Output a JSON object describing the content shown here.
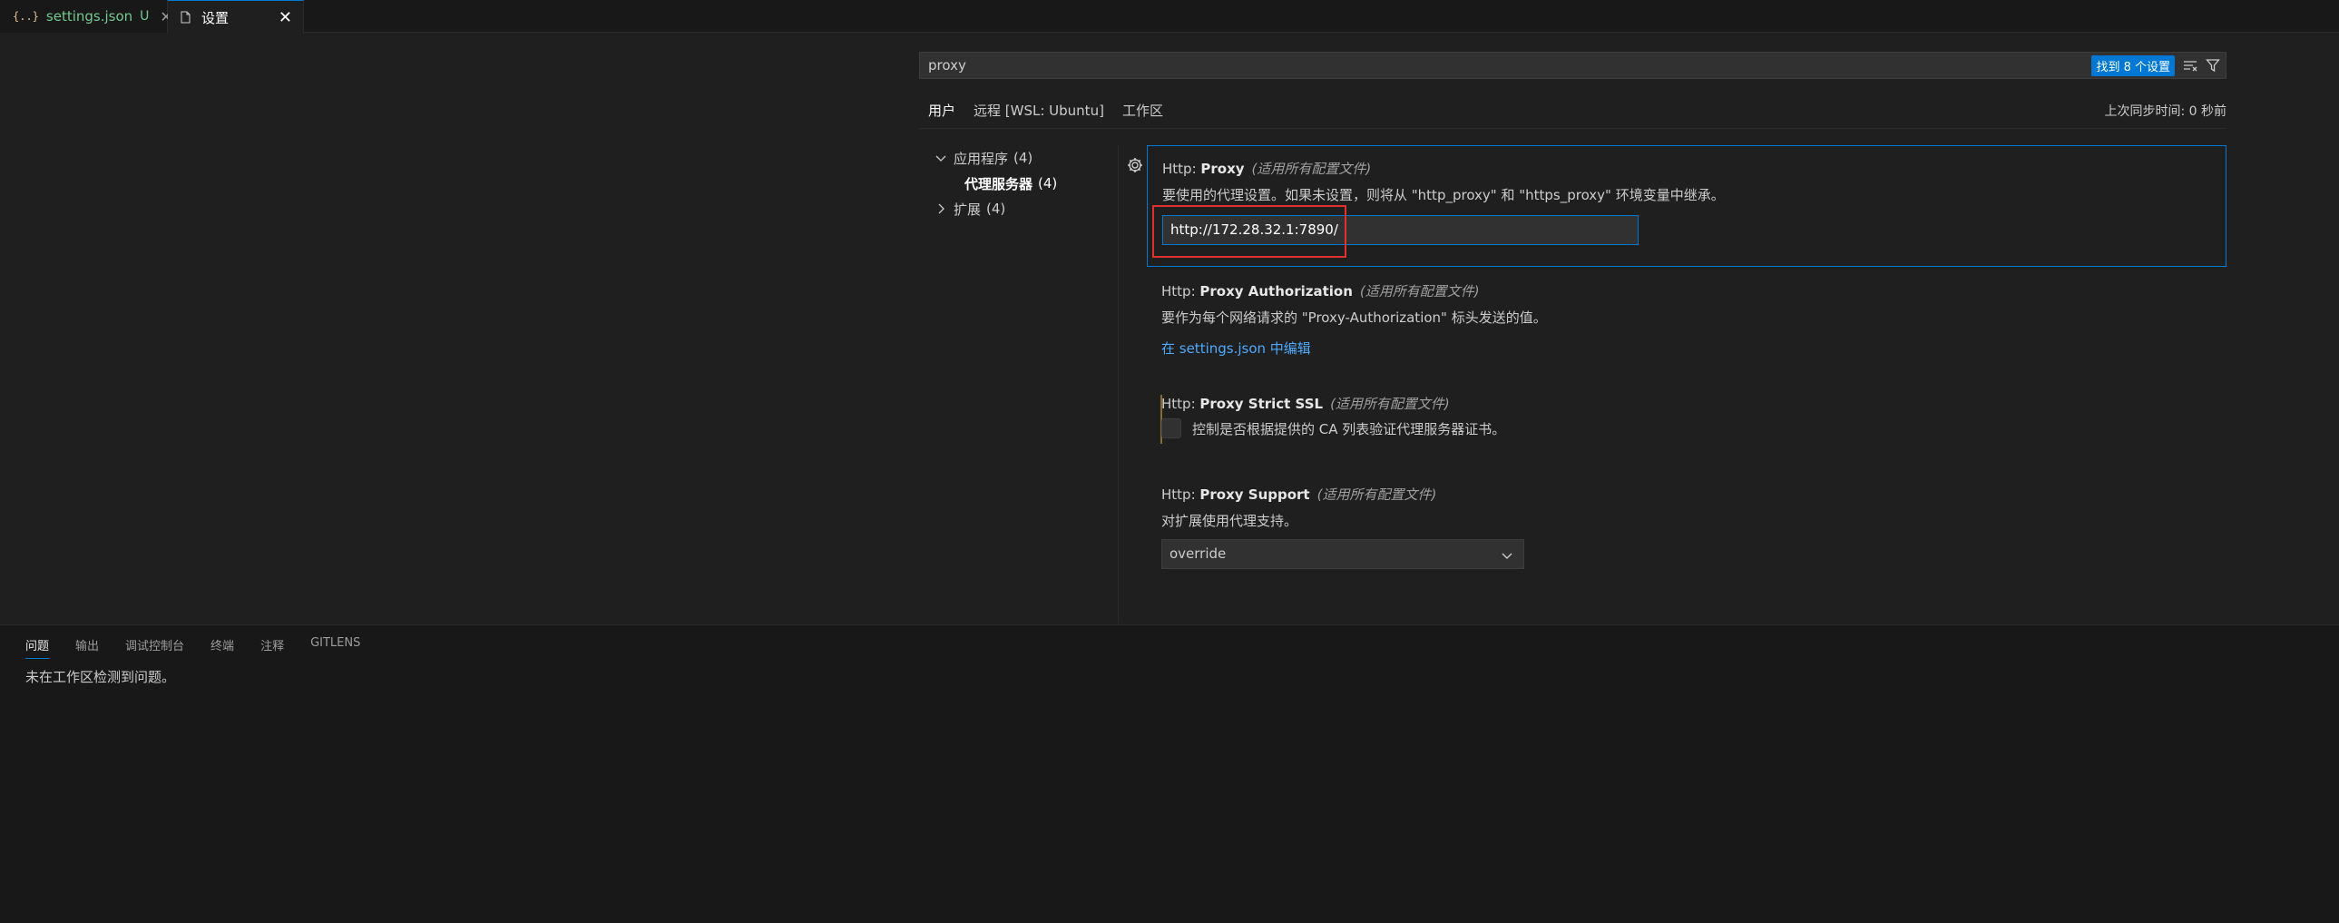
{
  "tabs": [
    {
      "icon": "{..}",
      "label": "settings.json",
      "status": "U",
      "close": "✕"
    },
    {
      "label": "设置",
      "close": "✕"
    }
  ],
  "search": {
    "value": "proxy",
    "result_badge": "找到 8 个设置"
  },
  "scope_tabs": [
    "用户",
    "远程 [WSL: Ubuntu]",
    "工作区"
  ],
  "sync_status": "上次同步时间: 0 秒前",
  "toc": {
    "group1": "应用程序",
    "group1_count": "(4)",
    "child1": "代理服务器",
    "child1_count": "(4)",
    "group2": "扩展",
    "group2_count": "(4)"
  },
  "settings": {
    "proxy": {
      "category": "Http: ",
      "name": "Proxy",
      "scope": "(适用所有配置文件)",
      "description": "要使用的代理设置。如果未设置，则将从 \"http_proxy\" 和 \"https_proxy\" 环境变量中继承。",
      "value": "http://172.28.32.1:7890/"
    },
    "proxy_authorization": {
      "category": "Http: ",
      "name": "Proxy Authorization",
      "scope": "(适用所有配置文件)",
      "description": "要作为每个网络请求的 \"Proxy-Authorization\" 标头发送的值。",
      "link": "在 settings.json 中编辑"
    },
    "proxy_strict_ssl": {
      "category": "Http: ",
      "name": "Proxy Strict SSL",
      "scope": "(适用所有配置文件)",
      "checkbox_label": "控制是否根据提供的 CA 列表验证代理服务器证书。",
      "checked": false
    },
    "proxy_support": {
      "category": "Http: ",
      "name": "Proxy Support",
      "scope": "(适用所有配置文件)",
      "description": "对扩展使用代理支持。",
      "selected": "override"
    }
  },
  "panel": {
    "tabs": [
      "问题",
      "输出",
      "调试控制台",
      "终端",
      "注释",
      "GITLENS"
    ],
    "message": "未在工作区检测到问题。"
  },
  "colors": {
    "accent": "#0078d4",
    "highlight": "#e03030",
    "link": "#4daafc",
    "modified_tab": "#73c991"
  }
}
